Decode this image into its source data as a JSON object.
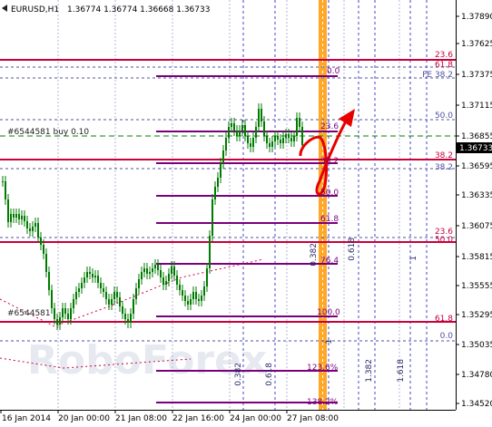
{
  "header": {
    "symbol_label": "EURUSD,H1",
    "ohlc": "1.36774 1.36774 1.36668 1.36733"
  },
  "orders": {
    "buy_label": "#6544581 buy 0.10",
    "order_label": "#6544581"
  },
  "price_axis": {
    "ticks": [
      "1.37890",
      "1.37625",
      "1.37375",
      "1.37115",
      "1.36855",
      "1.36595",
      "1.36335",
      "1.36075",
      "1.35815",
      "1.35555",
      "1.35295",
      "1.35035",
      "1.34780",
      "1.34520"
    ],
    "current_price": "1.36733"
  },
  "time_axis": {
    "ticks": [
      "16 Jan 2014",
      "20 Jan 00:00",
      "21 Jan 08:00",
      "22 Jan 16:00",
      "24 Jan 00:00",
      "27 Jan 08:00"
    ]
  },
  "fib_labels_right": [
    "23.6",
    "61.8",
    "FE 38.2",
    "50.0",
    "38.2",
    "38.2",
    "23.6",
    "50.0",
    "61.8",
    "0.0"
  ],
  "fib_labels_mid": [
    "0.0",
    "23.6",
    "38.2",
    "50.0",
    "61.8",
    "76.4",
    "100.0",
    "123.6%",
    "138.2%"
  ],
  "vertical_fib_labels": [
    "0.382",
    "0.618",
    "1",
    "0.382",
    "0.618",
    "1",
    "1.382",
    "1.618"
  ],
  "watermark": "RoboForex",
  "colors": {
    "background": "#ffffff",
    "candle": "#007a00",
    "fib_level": "#7a007a",
    "resistance_line": "#c8003c",
    "grid": "#b4b4d8",
    "vertical_band": "#ff9900",
    "arrow": "#e80000",
    "price_tag": "#000000"
  }
}
